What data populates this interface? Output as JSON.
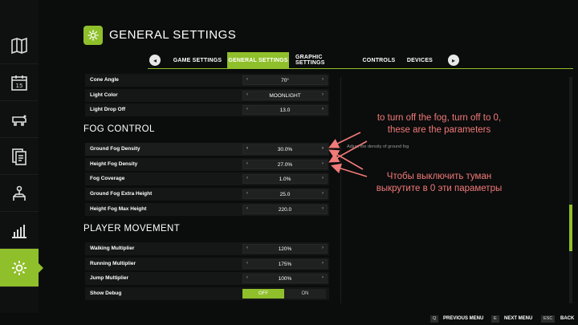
{
  "header": {
    "title": "GENERAL SETTINGS",
    "icon": "gear-icon"
  },
  "tabs": {
    "prev": "◂",
    "next": "▸",
    "items": [
      {
        "label": "GAME SETTINGS",
        "active": false
      },
      {
        "label": "GENERAL SETTINGS",
        "active": true
      },
      {
        "label": "GRAPHIC SETTINGS",
        "active": false
      },
      {
        "label": "CONTROLS",
        "active": false
      },
      {
        "label": "DEVICES",
        "active": false
      }
    ]
  },
  "sidebar": {
    "items": [
      {
        "icon": "map-icon"
      },
      {
        "icon": "calendar-icon"
      },
      {
        "icon": "animals-icon"
      },
      {
        "icon": "contracts-icon"
      },
      {
        "icon": "production-icon"
      },
      {
        "icon": "statistics-icon"
      },
      {
        "icon": "settings-icon",
        "active": true
      }
    ]
  },
  "settings": {
    "arrow_left": "‹",
    "arrow_right": "›",
    "top_rows": [
      {
        "label": "Cone Angle",
        "value": "70°"
      },
      {
        "label": "Light Color",
        "value": "MOONLIGHT"
      },
      {
        "label": "Light Drop Off",
        "value": "13.0"
      }
    ],
    "fog": {
      "title": "FOG CONTROL",
      "rows": [
        {
          "label": "Ground Fog Density",
          "value": "30.0%",
          "focused": true
        },
        {
          "label": "Height Fog Density",
          "value": "27.0%"
        },
        {
          "label": "Fog Coverage",
          "value": "1.0%"
        },
        {
          "label": "Ground Fog Extra Height",
          "value": "25.0"
        },
        {
          "label": "Height Fog Max Height",
          "value": "220.0"
        }
      ]
    },
    "player": {
      "title": "PLAYER MOVEMENT",
      "rows": [
        {
          "label": "Walking Multiplier",
          "value": "120%"
        },
        {
          "label": "Running Multiplier",
          "value": "175%"
        },
        {
          "label": "Jump Multiplier",
          "value": "100%"
        }
      ],
      "debug": {
        "label": "Show Debug",
        "off": "OFF",
        "on": "ON",
        "selected": "OFF"
      }
    },
    "tooltip": "Adjust the density of ground fog"
  },
  "annotations": {
    "english": "to turn off the fog, turn off to 0,\nthese are the parameters",
    "russian": "Чтобы выключить туман\nвыкрутите в 0 эти параметры",
    "color": "#f07a78"
  },
  "footer": [
    {
      "key": "Q",
      "label": "PREVIOUS MENU"
    },
    {
      "key": "E",
      "label": "NEXT MENU"
    },
    {
      "key": "ESC",
      "label": "BACK"
    }
  ],
  "colors": {
    "accent": "#8fbf2a",
    "background": "#0b0c0c"
  }
}
